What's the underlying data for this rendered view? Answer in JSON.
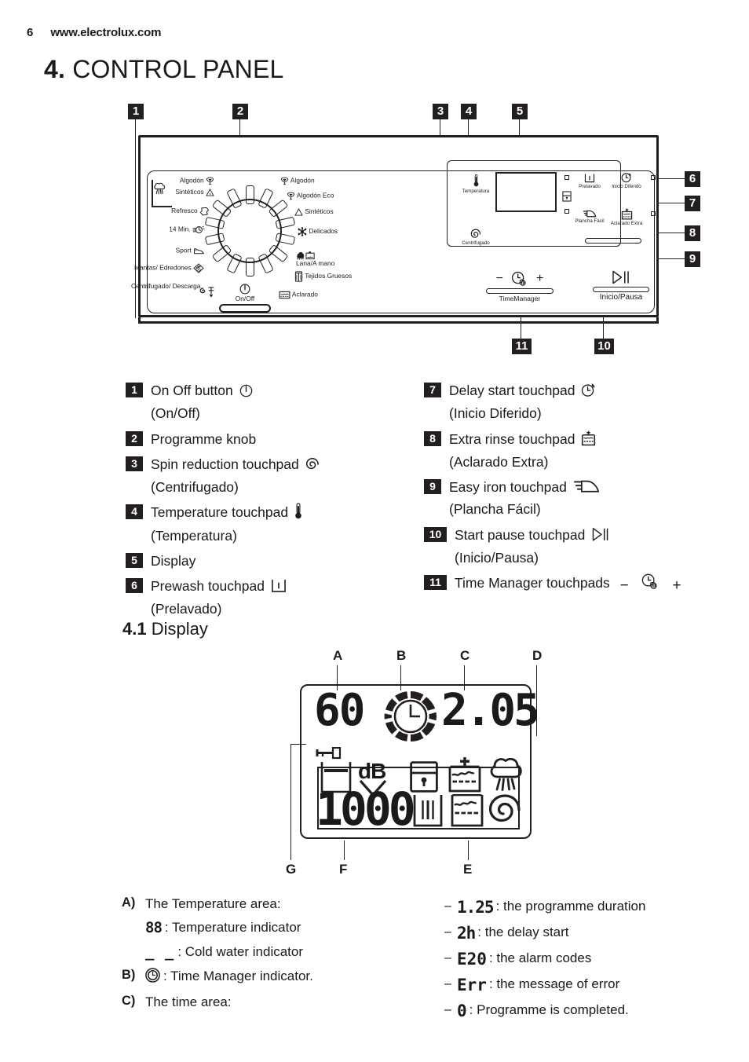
{
  "header": {
    "page_number": "6",
    "url": "www.electrolux.com"
  },
  "section": {
    "number": "4.",
    "title": "CONTROL PANEL"
  },
  "subsection": {
    "number": "4.1",
    "title": "Display"
  },
  "panel_diagram": {
    "callouts_top": [
      "1",
      "2",
      "3",
      "4",
      "5"
    ],
    "callouts_right": [
      "6",
      "7",
      "8",
      "9"
    ],
    "callouts_bottom": [
      "11",
      "10"
    ],
    "knob_labels_left": [
      {
        "text": "Algodón",
        "icon": "cotton-icon"
      },
      {
        "text": "Sintéticos",
        "icon": "synthetics-icon"
      },
      {
        "text": "Refresco",
        "icon": "refresh-icon"
      },
      {
        "text": "14 Min.",
        "icon": "quickwash-icon"
      },
      {
        "text": "Sport",
        "icon": "sport-icon"
      },
      {
        "text": "Mantas/ Edredones",
        "icon": "duvet-icon"
      },
      {
        "text": "Centrifugado/ Descarga",
        "icon": "spin-drain-icon"
      }
    ],
    "knob_labels_right": [
      {
        "text": "Algodón",
        "icon": "cotton-icon"
      },
      {
        "text": "Algodón Eco",
        "icon": "cotton-eco-icon"
      },
      {
        "text": "Sintéticos",
        "icon": "synthetics-icon"
      },
      {
        "text": "Delicados",
        "icon": "delicates-icon"
      },
      {
        "text": "Lana/A mano",
        "icon": "wool-handwash-icon"
      },
      {
        "text": "Tejidos Gruesos",
        "icon": "heavy-fabrics-icon"
      },
      {
        "text": "Aclarado",
        "icon": "rinse-icon"
      }
    ],
    "onoff_label": "On/Off",
    "pad_temperatura": "Temperatura",
    "pad_centrifugado": "Centrifugado",
    "pad_prelavado": "Prelavado",
    "pad_inicio_diferido": "Inicio Diferido",
    "pad_plancha_facil": "Plancha Fácil",
    "pad_aclarado_extra": "Aclarado Extra",
    "timemanager_label": "TimeManager",
    "timemanager_minus": "−",
    "timemanager_plus": "+",
    "inicio_pausa_label": "Inicio/Pausa"
  },
  "legend_left": [
    {
      "num": "1",
      "label": "On Off button",
      "icon": "power-icon",
      "sub": "(On/Off)"
    },
    {
      "num": "2",
      "label": "Programme knob",
      "icon": "",
      "sub": ""
    },
    {
      "num": "3",
      "label": "Spin reduction touchpad",
      "icon": "spin-icon",
      "sub": "(Centrifugado)"
    },
    {
      "num": "4",
      "label": "Temperature touchpad",
      "icon": "thermometer-icon",
      "sub": "(Temperatura)"
    },
    {
      "num": "5",
      "label": "Display",
      "icon": "",
      "sub": ""
    },
    {
      "num": "6",
      "label": "Prewash touchpad",
      "icon": "prewash-icon",
      "sub": "(Prelavado)"
    }
  ],
  "legend_right": [
    {
      "num": "7",
      "label": "Delay start touchpad",
      "icon": "delay-clock-icon",
      "sub": "(Inicio Diferido)"
    },
    {
      "num": "8",
      "label": "Extra rinse touchpad",
      "icon": "extra-rinse-icon",
      "sub": "(Aclarado Extra)"
    },
    {
      "num": "9",
      "label": "Easy iron touchpad",
      "icon": "iron-icon",
      "sub": "(Plancha Fácil)"
    },
    {
      "num": "10",
      "label": "Start pause touchpad",
      "icon": "play-pause-icon",
      "sub": "(Inicio/Pausa)"
    },
    {
      "num": "11",
      "label": "Time Manager touchpads",
      "icon": "timemanager-icon",
      "sub": ""
    }
  ],
  "display_diagram": {
    "letters_top": [
      "A",
      "B",
      "C",
      "D"
    ],
    "letters_bottom": [
      "G",
      "F",
      "E"
    ],
    "temperature_value": "60",
    "time_value": "2.05",
    "spin_value": "1000",
    "db_label": "dB",
    "icons": [
      "key-lock-icon",
      "laundry-basket-icon",
      "db-arrow-icon",
      "child-lock-icon",
      "extra-rinse-icon",
      "easy-care-icon",
      "prewash-icon",
      "rinse-hold-icon",
      "spin-icon"
    ]
  },
  "explanations_left": [
    {
      "key": "A)",
      "text": "The Temperature area:"
    },
    {
      "key": "",
      "text": ": Temperature indicator",
      "glyph": "88",
      "indent": true
    },
    {
      "key": "",
      "text": ": Cold water indicator",
      "glyph": "_ _",
      "indent": true
    },
    {
      "key": "B)",
      "text": ": Time Manager indicator.",
      "glyph": "timemanager-icon"
    },
    {
      "key": "C)",
      "text": "The time area:"
    }
  ],
  "explanations_right": [
    {
      "dash": "–",
      "glyph": "1.25",
      "text": ": the programme duration"
    },
    {
      "dash": "–",
      "glyph": "2h",
      "text": ": the delay start"
    },
    {
      "dash": "–",
      "glyph": "E20",
      "text": ": the alarm codes"
    },
    {
      "dash": "–",
      "glyph": "Err",
      "text": ": the message of error"
    },
    {
      "dash": "–",
      "glyph": "0",
      "text": ": Programme is completed."
    }
  ],
  "colors": {
    "ink": "#231f20",
    "paper": "#ffffff"
  }
}
